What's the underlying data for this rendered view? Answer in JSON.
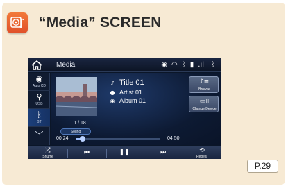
{
  "heading": "“Media” SCREEN",
  "page_ref": "P.29",
  "colors": {
    "card_bg": "#f7ead4",
    "icon_orange": "#e8602f",
    "screen_bg": "#0b1628",
    "accent_blue": "#1c3f7a"
  },
  "topbar": {
    "home_icon": "home-icon",
    "label": "Media",
    "status_icons": [
      "disc-icon",
      "wifi-icon",
      "bluetooth-icon",
      "phone-battery-icon",
      "signal-icon",
      "bluetooth-icon"
    ]
  },
  "sources": [
    {
      "icon": "cd-icon",
      "label": "Auto CD",
      "active": false
    },
    {
      "icon": "usb-icon",
      "label": "USB",
      "active": false
    },
    {
      "icon": "bluetooth-icon",
      "label": "BT",
      "active": true
    }
  ],
  "now_playing": {
    "title": "Title 01",
    "artist": "Artist 01",
    "album": "Album 01",
    "counter": "1 / 18",
    "sound_label": "Sound",
    "elapsed": "00:24",
    "total": "04:50",
    "progress": 0.08
  },
  "right_buttons": [
    {
      "icon": "browse-icon",
      "label": "Browse"
    },
    {
      "icon": "change-device-icon",
      "label": "Change Device"
    }
  ],
  "controls": [
    {
      "icon": "shuffle-icon",
      "label": "Shuffle"
    },
    {
      "icon": "previous-track-icon",
      "label": ""
    },
    {
      "icon": "pause-icon",
      "label": ""
    },
    {
      "icon": "next-track-icon",
      "label": ""
    },
    {
      "icon": "repeat-icon",
      "label": "Repeat"
    }
  ]
}
